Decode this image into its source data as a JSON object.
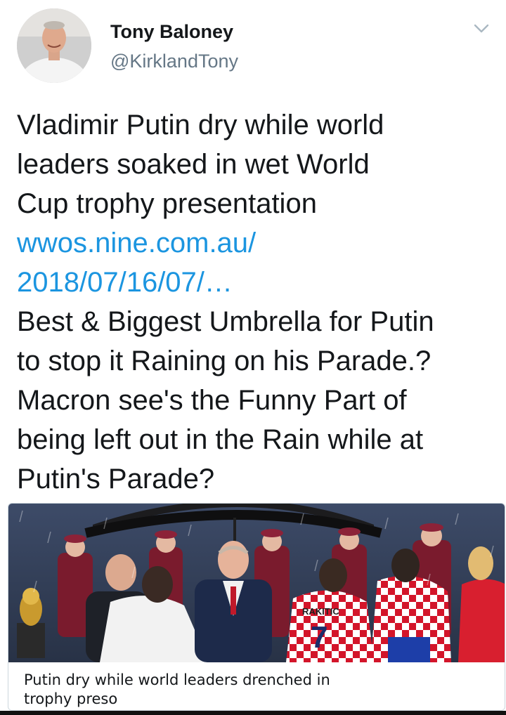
{
  "author": {
    "name": "Tony Baloney",
    "handle": "@KirklandTony",
    "avatar_icon": "profile-photo"
  },
  "menu_icon": "chevron-down-icon",
  "tweet": {
    "lines": [
      "Vladimir Putin dry while world",
      "leaders soaked in wet World",
      "Cup trophy presentation"
    ],
    "link_lines": [
      "wwos.nine.com.au/",
      "2018/07/16/07/…"
    ],
    "body_lines": [
      "Best & Biggest Umbrella for Putin",
      "to stop it Raining on his Parade.?",
      "Macron see's the Funny Part of",
      "being left out in the Rain while at",
      "Putin's Parade?"
    ]
  },
  "card": {
    "title_lines": [
      "Putin dry while world leaders drenched in",
      "trophy preso"
    ],
    "image_text": {
      "jersey_name": "RAKITIC",
      "jersey_number": "7"
    }
  },
  "colors": {
    "link": "#1b95e0",
    "handle": "#657786",
    "text": "#14171a"
  }
}
